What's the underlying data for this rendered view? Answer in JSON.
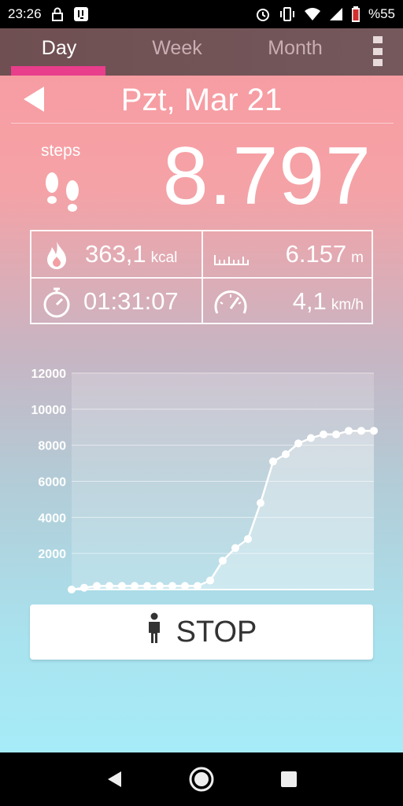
{
  "status_bar": {
    "time": "23:26",
    "battery": "%55",
    "icons_left": [
      "lock-icon",
      "app-notification-icon"
    ],
    "icons_right": [
      "alarm-icon",
      "vibrate-icon",
      "wifi-icon",
      "signal-icon",
      "battery-icon"
    ]
  },
  "tabs": [
    {
      "label": "Day",
      "active": true
    },
    {
      "label": "Week",
      "active": false
    },
    {
      "label": "Month",
      "active": false
    }
  ],
  "date_nav": {
    "date": "Pzt, Mar 21"
  },
  "steps": {
    "label": "steps",
    "count": "8.797"
  },
  "stats": {
    "calories": {
      "value": "363,1",
      "unit": "kcal"
    },
    "distance": {
      "value": "6.157",
      "unit": "m"
    },
    "duration": {
      "value": "01:31:07"
    },
    "speed": {
      "value": "4,1",
      "unit": "km/h"
    }
  },
  "chart_data": {
    "type": "line",
    "x": [
      0,
      1,
      2,
      3,
      4,
      5,
      6,
      7,
      8,
      9,
      10,
      11,
      12,
      13,
      14,
      15,
      16,
      17,
      18,
      19,
      20,
      21,
      22,
      23,
      24
    ],
    "values": [
      0,
      100,
      200,
      200,
      200,
      200,
      200,
      200,
      200,
      200,
      200,
      500,
      1600,
      2300,
      2800,
      4800,
      7100,
      7500,
      8100,
      8400,
      8600,
      8600,
      8800,
      8800,
      8800
    ],
    "x_ticks": [
      2,
      4,
      6,
      8,
      10,
      12,
      14,
      16,
      18,
      20,
      22,
      24
    ],
    "y_ticks": [
      2000,
      4000,
      6000,
      8000,
      10000,
      12000
    ],
    "xlim": [
      0,
      24
    ],
    "ylim": [
      0,
      12000
    ],
    "xlabel": "",
    "ylabel": "",
    "title": ""
  },
  "colors": {
    "accent": "#e83e8c",
    "tab_bar": "#6f4f51"
  },
  "stop_button": {
    "label": "STOP"
  }
}
